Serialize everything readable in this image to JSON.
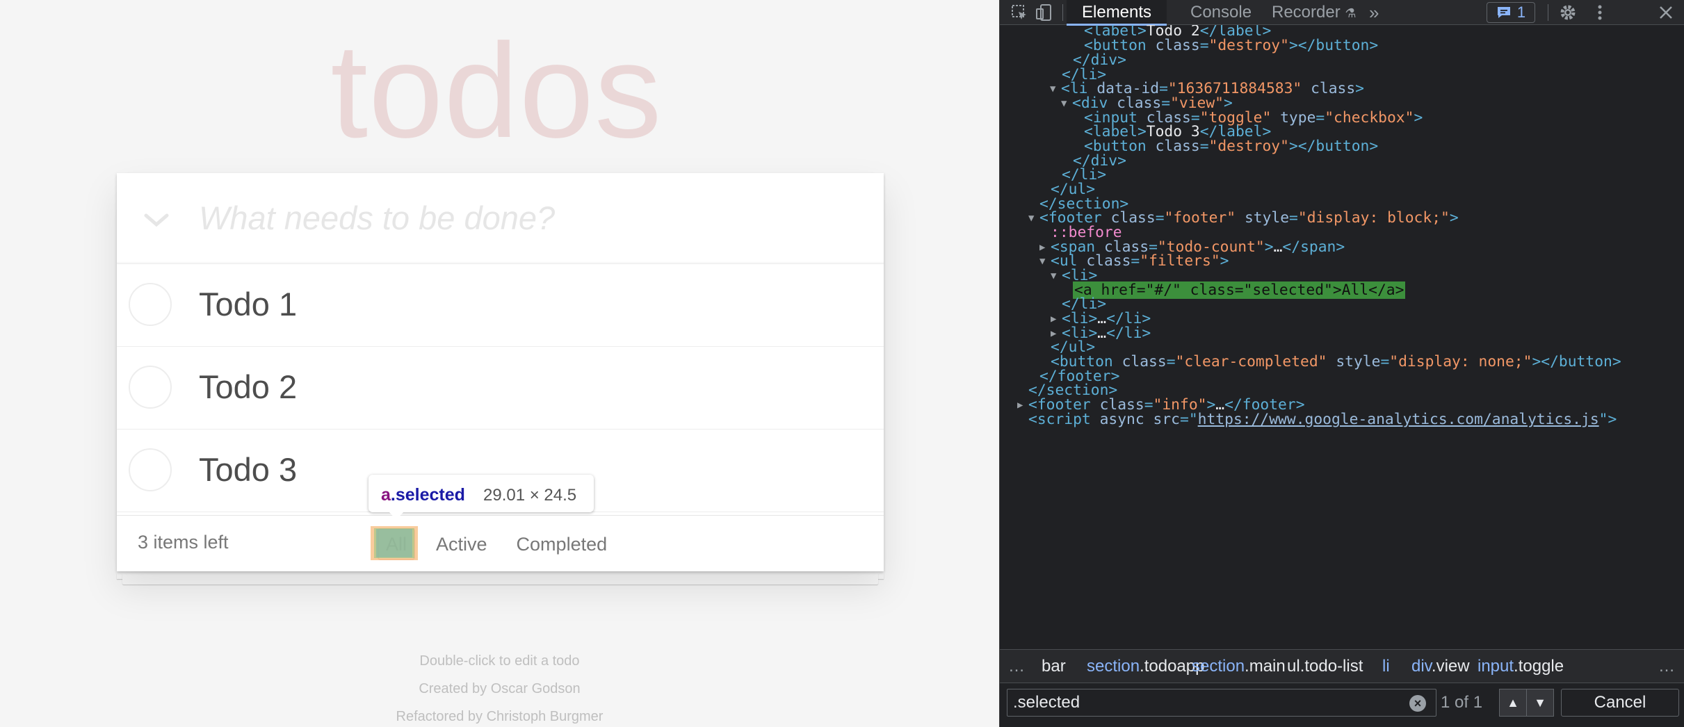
{
  "todomvc": {
    "title": "todos",
    "new_todo_placeholder": "What needs to be done?",
    "todos": [
      {
        "label": "Todo 1",
        "completed": false
      },
      {
        "label": "Todo 2",
        "completed": false
      },
      {
        "label": "Todo 3",
        "completed": false
      }
    ],
    "footer": {
      "count_text": "3 items left",
      "filters": [
        "All",
        "Active",
        "Completed"
      ],
      "selected_filter": "All"
    },
    "info": {
      "line1": "Double-click to edit a todo",
      "line2_prefix": "Created by ",
      "line2_author": "Oscar Godson",
      "line3_prefix": "Refactored by ",
      "line3_author": "Christoph Burgmer"
    }
  },
  "inspector_tooltip": {
    "tag": "a",
    "class": ".selected",
    "dimensions": "29.01 × 24.5"
  },
  "devtools": {
    "tabs": [
      "Elements",
      "Console",
      "Recorder"
    ],
    "active_tab": "Elements",
    "more_tabs_icon": "chevron-double-right-icon",
    "issues_badge_count": "1",
    "dom_lines": {
      "l0_tag": "label",
      "l0_text": "Todo 2",
      "l1_tag": "button",
      "l1_attr": "class",
      "l1_val": "\"destroy\"",
      "l2_tag": "/div",
      "l3_tag": "/li",
      "l4_tag": "li",
      "l4_attr1": "data-id",
      "l4_val1": "\"1636711884583\"",
      "l4_attr2": "class",
      "l5_tag": "div",
      "l5_attr": "class",
      "l5_val": "\"view\"",
      "l6_tag": "input",
      "l6_attr1": "class",
      "l6_val1": "\"toggle\"",
      "l6_attr2": "type",
      "l6_val2": "\"checkbox\"",
      "l7_tag": "label",
      "l7_text": "Todo 3",
      "l8_tag": "button",
      "l8_attr": "class",
      "l8_val": "\"destroy\"",
      "l9_tag": "/div",
      "l10_tag": "/li",
      "l11_tag": "/ul",
      "l12_tag": "/section",
      "l13_tag": "footer",
      "l13_attr1": "class",
      "l13_val1": "\"footer\"",
      "l13_attr2": "style",
      "l13_val2": "\"display: block;\"",
      "l14_pseudo": "::before",
      "l15_tag": "span",
      "l15_attr": "class",
      "l15_val": "\"todo-count\"",
      "l15_ellipsis": "…",
      "l16_tag": "ul",
      "l16_attr": "class",
      "l16_val": "\"filters\"",
      "l17_tag": "li",
      "l18_text": "<a href=\"#/\" class=\"selected\">All</a>",
      "l19_tag": "/li",
      "l20_text": "…",
      "l21_text": "…",
      "l22_tag": "/ul",
      "l23_tag": "button",
      "l23_attr1": "class",
      "l23_val1": "\"clear-completed\"",
      "l23_attr2": "style",
      "l23_val2": "\"display: none;\"",
      "l24_tag": "/footer",
      "l25_tag": "/section",
      "l26_tag": "footer",
      "l26_attr": "class",
      "l26_val": "\"info\"",
      "l26_ellipsis": "…",
      "l27_tag": "script",
      "l27_attr1": "async",
      "l27_attr2": "src",
      "l27_url": "https://www.google-analytics.com/analytics.js"
    },
    "breadcrumbs": [
      {
        "tag": "…",
        "cls": ""
      },
      {
        "tag": "bar",
        "cls": ""
      },
      {
        "tag": "section",
        "cls": ".todoapp"
      },
      {
        "tag": "section",
        "cls": ".main"
      },
      {
        "tag": "ul",
        "cls": ".todo-list"
      },
      {
        "tag": "li",
        "cls": ""
      },
      {
        "tag": "div",
        "cls": ".view"
      },
      {
        "tag": "input",
        "cls": ".toggle"
      },
      {
        "tag": "…",
        "cls": ""
      }
    ],
    "search": {
      "value": ".selected",
      "match_text": "1 of 1",
      "cancel_label": "Cancel"
    }
  },
  "colors": {
    "title_color": "rgba(175,47,47,0.15)",
    "devtools_bg": "#202124",
    "selected_node_bg": "#3c8f3c",
    "accent_blue": "#8ab4f8"
  }
}
